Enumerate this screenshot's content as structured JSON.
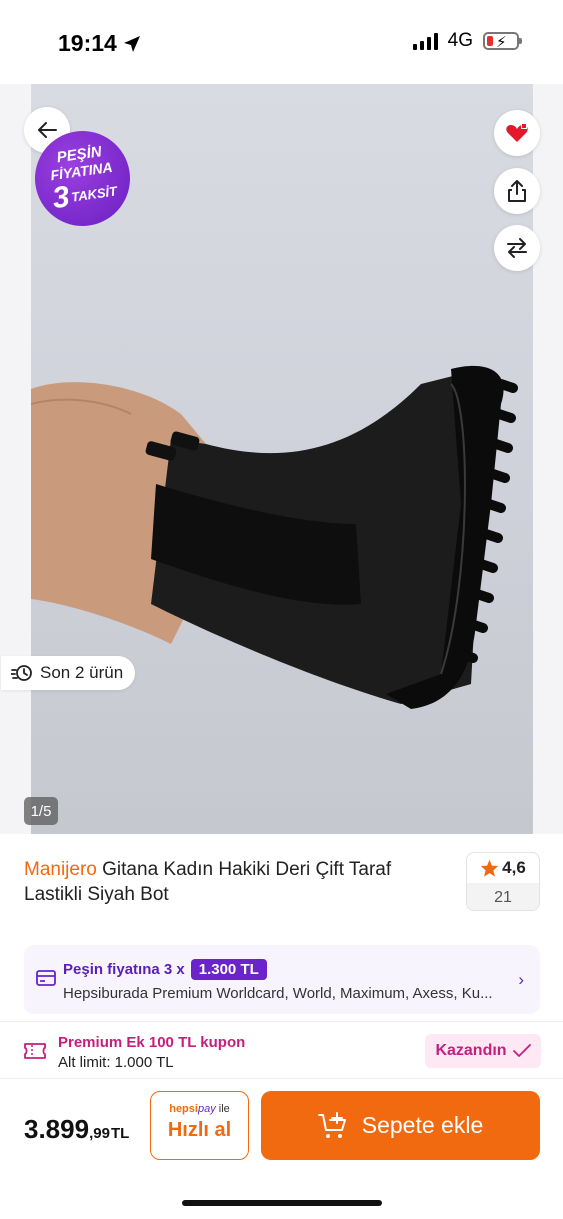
{
  "status_bar": {
    "time": "19:14",
    "network": "4G"
  },
  "hero": {
    "promo_badge": {
      "line1": "PEŞİN",
      "line2": "FİYATINA",
      "line3_number": "3",
      "line3_text": "TAKSİT"
    },
    "stock_label": "Son 2 ürün",
    "page_indicator": "1/5"
  },
  "product": {
    "brand": "Manijero",
    "name": "Gitana Kadın Hakiki Deri Çift Taraf Lastikli Siyah Bot",
    "rating": "4,6",
    "review_count": "21"
  },
  "installment": {
    "label": "Peşin fiyatına 3 x",
    "amount": "1.300 TL",
    "cards": "Hepsiburada Premium Worldcard, World, Maximum, Axess, Ku..."
  },
  "coupon": {
    "title": "Premium Ek 100 TL kupon",
    "limit": "Alt limit: 1.000 TL",
    "action": "Kazandın"
  },
  "purchase": {
    "price_main": "3.899",
    "price_decimal": ",99",
    "currency": "TL",
    "quick_brand_hepsi": "hepsi",
    "quick_brand_pay": "pay",
    "quick_brand_suffix": " ile",
    "quick_label": "Hızlı al",
    "cart_label": "Sepete ekle"
  },
  "colors": {
    "accent_orange": "#f26a10",
    "accent_purple": "#6a24c9",
    "coupon_pink": "#c51f7e"
  }
}
